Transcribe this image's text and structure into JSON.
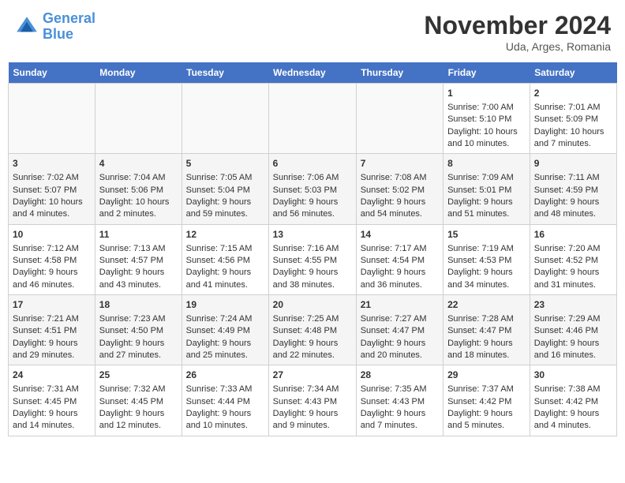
{
  "header": {
    "logo_line1": "General",
    "logo_line2": "Blue",
    "month": "November 2024",
    "location": "Uda, Arges, Romania"
  },
  "weekdays": [
    "Sunday",
    "Monday",
    "Tuesday",
    "Wednesday",
    "Thursday",
    "Friday",
    "Saturday"
  ],
  "weeks": [
    [
      {
        "day": "",
        "content": ""
      },
      {
        "day": "",
        "content": ""
      },
      {
        "day": "",
        "content": ""
      },
      {
        "day": "",
        "content": ""
      },
      {
        "day": "",
        "content": ""
      },
      {
        "day": "1",
        "content": "Sunrise: 7:00 AM\nSunset: 5:10 PM\nDaylight: 10 hours and 10 minutes."
      },
      {
        "day": "2",
        "content": "Sunrise: 7:01 AM\nSunset: 5:09 PM\nDaylight: 10 hours and 7 minutes."
      }
    ],
    [
      {
        "day": "3",
        "content": "Sunrise: 7:02 AM\nSunset: 5:07 PM\nDaylight: 10 hours and 4 minutes."
      },
      {
        "day": "4",
        "content": "Sunrise: 7:04 AM\nSunset: 5:06 PM\nDaylight: 10 hours and 2 minutes."
      },
      {
        "day": "5",
        "content": "Sunrise: 7:05 AM\nSunset: 5:04 PM\nDaylight: 9 hours and 59 minutes."
      },
      {
        "day": "6",
        "content": "Sunrise: 7:06 AM\nSunset: 5:03 PM\nDaylight: 9 hours and 56 minutes."
      },
      {
        "day": "7",
        "content": "Sunrise: 7:08 AM\nSunset: 5:02 PM\nDaylight: 9 hours and 54 minutes."
      },
      {
        "day": "8",
        "content": "Sunrise: 7:09 AM\nSunset: 5:01 PM\nDaylight: 9 hours and 51 minutes."
      },
      {
        "day": "9",
        "content": "Sunrise: 7:11 AM\nSunset: 4:59 PM\nDaylight: 9 hours and 48 minutes."
      }
    ],
    [
      {
        "day": "10",
        "content": "Sunrise: 7:12 AM\nSunset: 4:58 PM\nDaylight: 9 hours and 46 minutes."
      },
      {
        "day": "11",
        "content": "Sunrise: 7:13 AM\nSunset: 4:57 PM\nDaylight: 9 hours and 43 minutes."
      },
      {
        "day": "12",
        "content": "Sunrise: 7:15 AM\nSunset: 4:56 PM\nDaylight: 9 hours and 41 minutes."
      },
      {
        "day": "13",
        "content": "Sunrise: 7:16 AM\nSunset: 4:55 PM\nDaylight: 9 hours and 38 minutes."
      },
      {
        "day": "14",
        "content": "Sunrise: 7:17 AM\nSunset: 4:54 PM\nDaylight: 9 hours and 36 minutes."
      },
      {
        "day": "15",
        "content": "Sunrise: 7:19 AM\nSunset: 4:53 PM\nDaylight: 9 hours and 34 minutes."
      },
      {
        "day": "16",
        "content": "Sunrise: 7:20 AM\nSunset: 4:52 PM\nDaylight: 9 hours and 31 minutes."
      }
    ],
    [
      {
        "day": "17",
        "content": "Sunrise: 7:21 AM\nSunset: 4:51 PM\nDaylight: 9 hours and 29 minutes."
      },
      {
        "day": "18",
        "content": "Sunrise: 7:23 AM\nSunset: 4:50 PM\nDaylight: 9 hours and 27 minutes."
      },
      {
        "day": "19",
        "content": "Sunrise: 7:24 AM\nSunset: 4:49 PM\nDaylight: 9 hours and 25 minutes."
      },
      {
        "day": "20",
        "content": "Sunrise: 7:25 AM\nSunset: 4:48 PM\nDaylight: 9 hours and 22 minutes."
      },
      {
        "day": "21",
        "content": "Sunrise: 7:27 AM\nSunset: 4:47 PM\nDaylight: 9 hours and 20 minutes."
      },
      {
        "day": "22",
        "content": "Sunrise: 7:28 AM\nSunset: 4:47 PM\nDaylight: 9 hours and 18 minutes."
      },
      {
        "day": "23",
        "content": "Sunrise: 7:29 AM\nSunset: 4:46 PM\nDaylight: 9 hours and 16 minutes."
      }
    ],
    [
      {
        "day": "24",
        "content": "Sunrise: 7:31 AM\nSunset: 4:45 PM\nDaylight: 9 hours and 14 minutes."
      },
      {
        "day": "25",
        "content": "Sunrise: 7:32 AM\nSunset: 4:45 PM\nDaylight: 9 hours and 12 minutes."
      },
      {
        "day": "26",
        "content": "Sunrise: 7:33 AM\nSunset: 4:44 PM\nDaylight: 9 hours and 10 minutes."
      },
      {
        "day": "27",
        "content": "Sunrise: 7:34 AM\nSunset: 4:43 PM\nDaylight: 9 hours and 9 minutes."
      },
      {
        "day": "28",
        "content": "Sunrise: 7:35 AM\nSunset: 4:43 PM\nDaylight: 9 hours and 7 minutes."
      },
      {
        "day": "29",
        "content": "Sunrise: 7:37 AM\nSunset: 4:42 PM\nDaylight: 9 hours and 5 minutes."
      },
      {
        "day": "30",
        "content": "Sunrise: 7:38 AM\nSunset: 4:42 PM\nDaylight: 9 hours and 4 minutes."
      }
    ]
  ]
}
